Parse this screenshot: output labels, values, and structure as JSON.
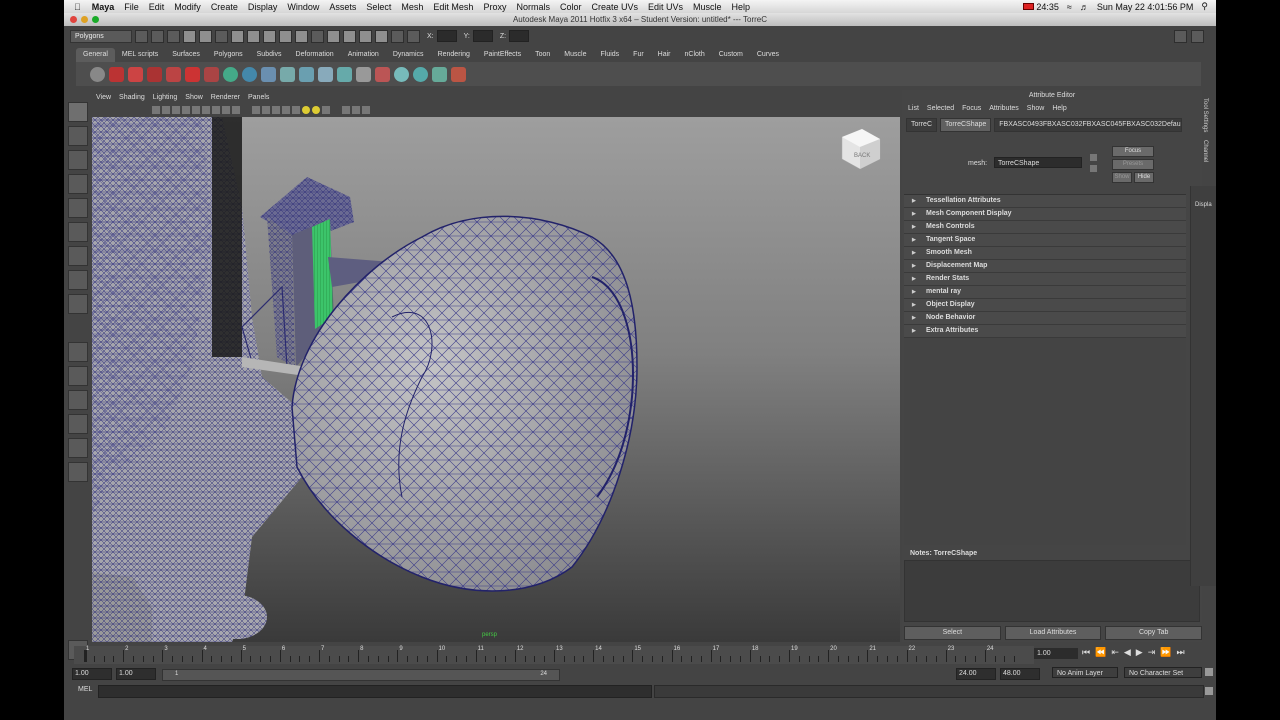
{
  "mac_menubar": {
    "app": "Maya",
    "items": [
      "File",
      "Edit",
      "Modify",
      "Create",
      "Display",
      "Window",
      "Assets",
      "Select",
      "Mesh",
      "Edit Mesh",
      "Proxy",
      "Normals",
      "Color",
      "Create UVs",
      "Edit UVs",
      "Muscle",
      "Help"
    ],
    "battery": "24:35",
    "clock": "Sun May 22  4:01:56 PM"
  },
  "window_title": "Autodesk Maya 2011 Hotfix 3 x64 – Student Version: untitled*   ---   TorreC",
  "status_line": {
    "mode_dropdown": "Polygons",
    "x_label": "X:",
    "y_label": "Y:",
    "z_label": "Z:"
  },
  "shelf_tabs": [
    "General",
    "MEL scripts",
    "Surfaces",
    "Polygons",
    "Subdivs",
    "Deformation",
    "Animation",
    "Dynamics",
    "Rendering",
    "PaintEffects",
    "Toon",
    "Muscle",
    "Fluids",
    "Fur",
    "Hair",
    "nCloth",
    "Custom",
    "Curves"
  ],
  "shelf_active_tab": "General",
  "viewport": {
    "menu": [
      "View",
      "Shading",
      "Lighting",
      "Show",
      "Renderer",
      "Panels"
    ],
    "camera_label": "persp",
    "viewcube_label": "BACK"
  },
  "attribute_editor": {
    "title": "Attribute Editor",
    "menu": [
      "List",
      "Selected",
      "Focus",
      "Attributes",
      "Show",
      "Help"
    ],
    "tabs": [
      "TorreC",
      "TorreCShape",
      "FBXASC0493FBXASC032FBXASC045FBXASC032Default"
    ],
    "active_tab": "TorreCShape",
    "mesh_label": "mesh:",
    "mesh_value": "TorreCShape",
    "focus_button": "Focus",
    "presets_button": "Presets",
    "show_button": "Show",
    "hide_button": "Hide",
    "sections": [
      "Tessellation Attributes",
      "Mesh Component Display",
      "Mesh Controls",
      "Tangent Space",
      "Smooth Mesh",
      "Displacement Map",
      "Render Stats",
      "mental ray",
      "Object Display",
      "Node Behavior",
      "Extra Attributes"
    ],
    "notes_label": "Notes:  TorreCShape",
    "buttons": [
      "Select",
      "Load Attributes",
      "Copy Tab"
    ]
  },
  "side_strip": [
    "Tool Settings",
    "Channel"
  ],
  "display_panel_label": "Displa",
  "time_slider": {
    "labels": [
      "1",
      "2",
      "3",
      "4",
      "5",
      "6",
      "7",
      "8",
      "9",
      "10",
      "11",
      "12",
      "13",
      "14",
      "15",
      "16",
      "17",
      "18",
      "19",
      "20",
      "21",
      "22",
      "23",
      "24"
    ],
    "current_frame": "1.00"
  },
  "range": {
    "start_time": "1.00",
    "playback_start": "1.00",
    "slider_start": "1",
    "slider_end": "24",
    "playback_end": "24.00",
    "end_time": "48.00",
    "anim_layer": "No Anim Layer",
    "character_set": "No Character Set"
  },
  "command_line": {
    "lang": "MEL"
  }
}
